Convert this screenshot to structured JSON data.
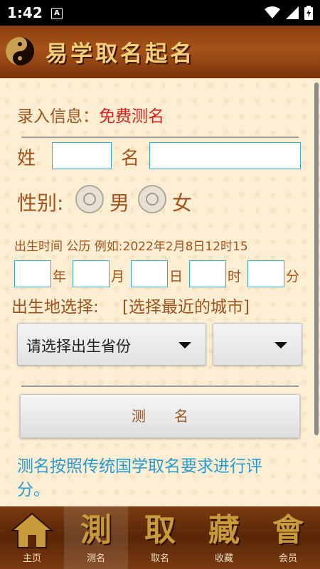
{
  "status": {
    "time": "1:42",
    "a_badge": "A"
  },
  "header": {
    "title": "易学取名起名"
  },
  "form": {
    "info_label": "录入信息：",
    "info_value": "免费测名",
    "surname_label": "姓",
    "name_label": "名",
    "gender_label": "性别:",
    "male_label": "男",
    "female_label": "女",
    "birth_hint": "出生时间 公历 例如:2022年2月8日12时15",
    "unit_year": "年",
    "unit_month": "月",
    "unit_day": "日",
    "unit_hour": "时",
    "unit_minute": "分",
    "birthplace_label": "出生地选择:",
    "birthplace_link": "[选择最近的城市]",
    "province_select": "请选择出生省份",
    "city_select": "",
    "submit_label": "测名"
  },
  "note": "测名按照传统国学取名要求进行评分。",
  "nav": [
    {
      "big": "⌂",
      "label": "主页"
    },
    {
      "big": "測",
      "label": "测名"
    },
    {
      "big": "取",
      "label": "取名"
    },
    {
      "big": "藏",
      "label": "收藏"
    },
    {
      "big": "會",
      "label": "会员"
    }
  ]
}
